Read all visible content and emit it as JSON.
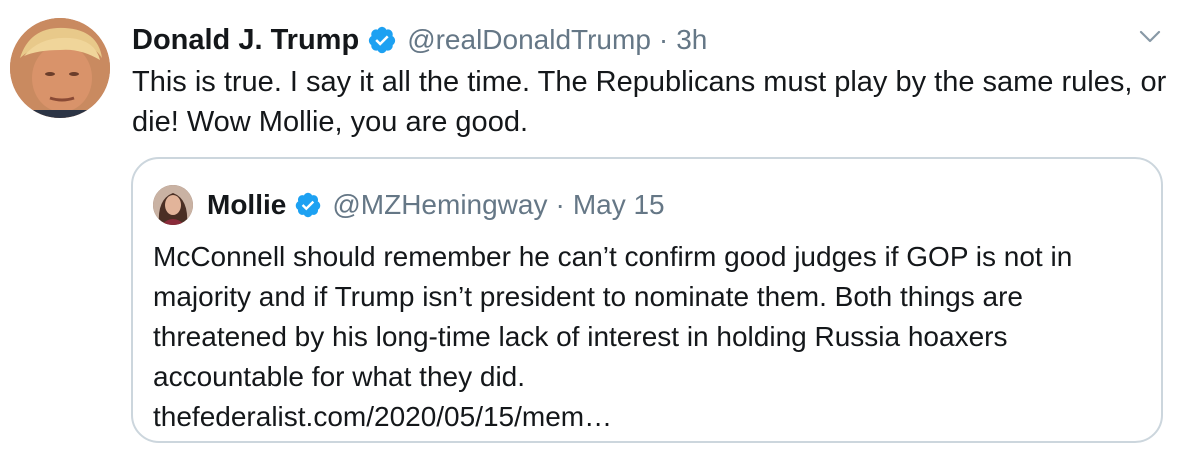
{
  "tweet": {
    "author_name": "Donald J. Trump",
    "handle": "@realDonaldTrump",
    "separator": "·",
    "time": "3h",
    "text": "This is true. I say it all the time. The Republicans must play by the same rules, or die! Wow Mollie, you are good.",
    "verified_icon": "verified-badge-icon",
    "menu_icon": "chevron-down-icon"
  },
  "quoted_tweet": {
    "author_name": "Mollie",
    "handle": "@MZHemingway",
    "separator": "·",
    "time": "May 15",
    "text": "McConnell should remember he can’t confirm good judges if GOP is not in majority and if Trump isn’t president to nominate them. Both things are threatened by his long-time lack of interest in holding Russia hoaxers accountable for what they did.",
    "link": "thefederalist.com/2020/05/15/mem…"
  },
  "colors": {
    "verified_blue": "#1da1f2",
    "secondary_text": "#657786",
    "border": "#ccd6dd"
  }
}
